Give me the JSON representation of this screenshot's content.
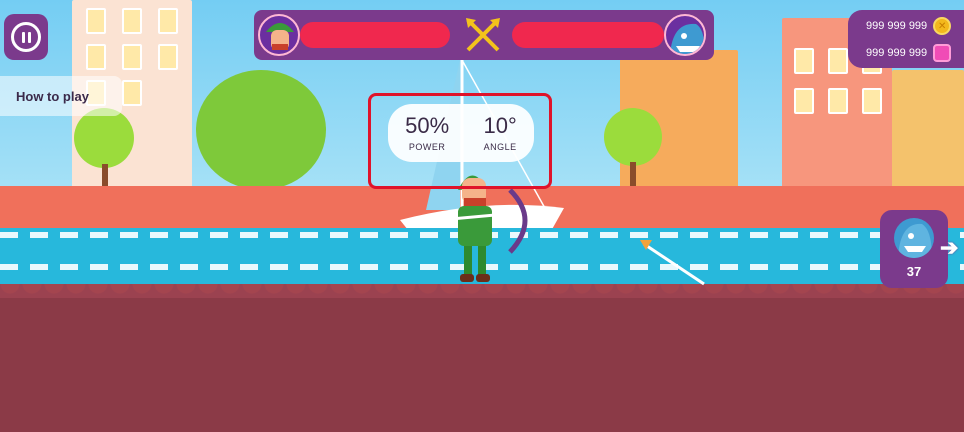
{
  "hud": {
    "how_to_play": "How to play",
    "stats": {
      "power_value": "50%",
      "power_label": "POWER",
      "angle_value": "10°",
      "angle_label": "ANGLE"
    },
    "currency": {
      "coins": "999 999 999",
      "gems": "999 999 999"
    },
    "health": {
      "player": 1.0,
      "opponent": 1.0
    },
    "next_opponent": {
      "count": "37"
    }
  },
  "icons": {
    "pause": "pause-icon",
    "crossed_arrows": "crossed-arrows-icon",
    "coin": "coin-icon",
    "gem": "gem-icon",
    "next": "arrow-right-icon"
  },
  "colors": {
    "hud_purple": "#7b3a8c",
    "health_red": "#f0284e",
    "highlight_red": "#e0132a",
    "water": "#27b8dc",
    "ground": "#8b3a47",
    "archer_green": "#3a9a3a"
  }
}
